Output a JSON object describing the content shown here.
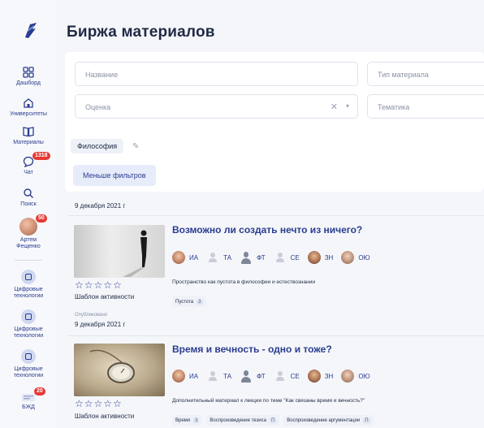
{
  "page": {
    "title": "Биржа материалов"
  },
  "sidebar": {
    "items": [
      {
        "label": "Дашборд",
        "icon": "dashboard-icon"
      },
      {
        "label": "Университеты",
        "icon": "university-icon"
      },
      {
        "label": "Материалы",
        "icon": "book-icon"
      },
      {
        "label": "Чат",
        "icon": "chat-icon",
        "badge": "1318"
      },
      {
        "label": "Поиск",
        "icon": "search-icon"
      },
      {
        "label_1": "Артем",
        "label_2": "Фещенко",
        "icon": "avatar",
        "badge": "50"
      }
    ],
    "groups": [
      {
        "label_1": "Цифровые",
        "label_2": "технологии",
        "icon": "digital-tech-icon"
      },
      {
        "label_1": "Цифровые",
        "label_2": "технологии",
        "icon": "digital-tech-icon"
      },
      {
        "label_1": "Цифровые",
        "label_2": "технологии",
        "icon": "digital-tech-icon"
      },
      {
        "label": "БЖД",
        "icon": "bzhd-icon",
        "badge": "20"
      }
    ]
  },
  "filters": {
    "name_placeholder": "Название",
    "type_placeholder": "Тип материала",
    "rating_placeholder": "Оценка",
    "topic_placeholder": "Тематика",
    "active_chip": "Философия",
    "less_filters": "Меньше фильтров"
  },
  "feed": {
    "date_1": "9 декабря 2021 г",
    "cards": [
      {
        "title": "Возможно ли создать нечто из ничего?",
        "people": [
          {
            "initials": "ИА",
            "avatar": "photo1"
          },
          {
            "initials": "ТА",
            "avatar": "ghost"
          },
          {
            "initials": "ФТ",
            "avatar": "dark"
          },
          {
            "initials": "СЕ",
            "avatar": "ghost"
          },
          {
            "initials": "ЗН",
            "avatar": "photo2"
          },
          {
            "initials": "ОЮ",
            "avatar": "photo3"
          }
        ],
        "stars": "☆☆☆☆☆",
        "template": "Шаблон активности",
        "description": "Пространство как пустота в философии и естествознании",
        "tags": [
          {
            "label": "Пустота",
            "count": "3"
          }
        ],
        "published_label": "Опубликовано",
        "published_date": "9 декабря 2021 г"
      },
      {
        "title": "Время и вечность - одно и тоже?",
        "people": [
          {
            "initials": "ИА",
            "avatar": "photo1"
          },
          {
            "initials": "ТА",
            "avatar": "ghost"
          },
          {
            "initials": "ФТ",
            "avatar": "dark"
          },
          {
            "initials": "СЕ",
            "avatar": "ghost"
          },
          {
            "initials": "ЗН",
            "avatar": "photo2"
          },
          {
            "initials": "ОЮ",
            "avatar": "photo3"
          }
        ],
        "stars": "☆☆☆☆☆",
        "template": "Шаблон активности",
        "description": "Дополнительный материал к лекции по теме \"Как связаны время и вечность?\"",
        "tags": [
          {
            "label": "Время",
            "count": "3"
          },
          {
            "label": "Воспроизведение тезиса",
            "count": "П"
          },
          {
            "label": "Воспроизведение аргументации",
            "count": "П"
          }
        ]
      }
    ]
  },
  "colors": {
    "accent": "#2a3d8f",
    "badge": "#e53935",
    "background": "#f4f6fa"
  }
}
